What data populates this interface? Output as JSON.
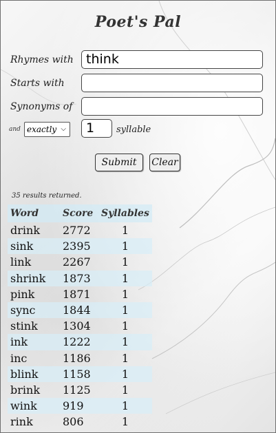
{
  "title": "Poet's Pal",
  "form": {
    "rhymes_label": "Rhymes with",
    "rhymes_value": "think",
    "starts_label": "Starts with",
    "starts_value": "",
    "synonyms_label": "Synonyms of",
    "synonyms_value": "",
    "and_label": "and",
    "match_mode": "exactly",
    "syllable_count": "1",
    "syllable_label": "syllable",
    "submit_label": "Submit",
    "clear_label": "Clear"
  },
  "results": {
    "count_text": "35 results returned.",
    "headers": [
      "Word",
      "Score",
      "Syllables"
    ],
    "rows": [
      [
        "drink",
        "2772",
        "1"
      ],
      [
        "sink",
        "2395",
        "1"
      ],
      [
        "link",
        "2267",
        "1"
      ],
      [
        "shrink",
        "1873",
        "1"
      ],
      [
        "pink",
        "1871",
        "1"
      ],
      [
        "sync",
        "1844",
        "1"
      ],
      [
        "stink",
        "1304",
        "1"
      ],
      [
        "ink",
        "1222",
        "1"
      ],
      [
        "inc",
        "1186",
        "1"
      ],
      [
        "blink",
        "1158",
        "1"
      ],
      [
        "brink",
        "1125",
        "1"
      ],
      [
        "wink",
        "919",
        "1"
      ],
      [
        "rink",
        "806",
        "1"
      ]
    ]
  },
  "colors": {
    "row_stripe": "#d7eef8",
    "border": "#444444"
  }
}
